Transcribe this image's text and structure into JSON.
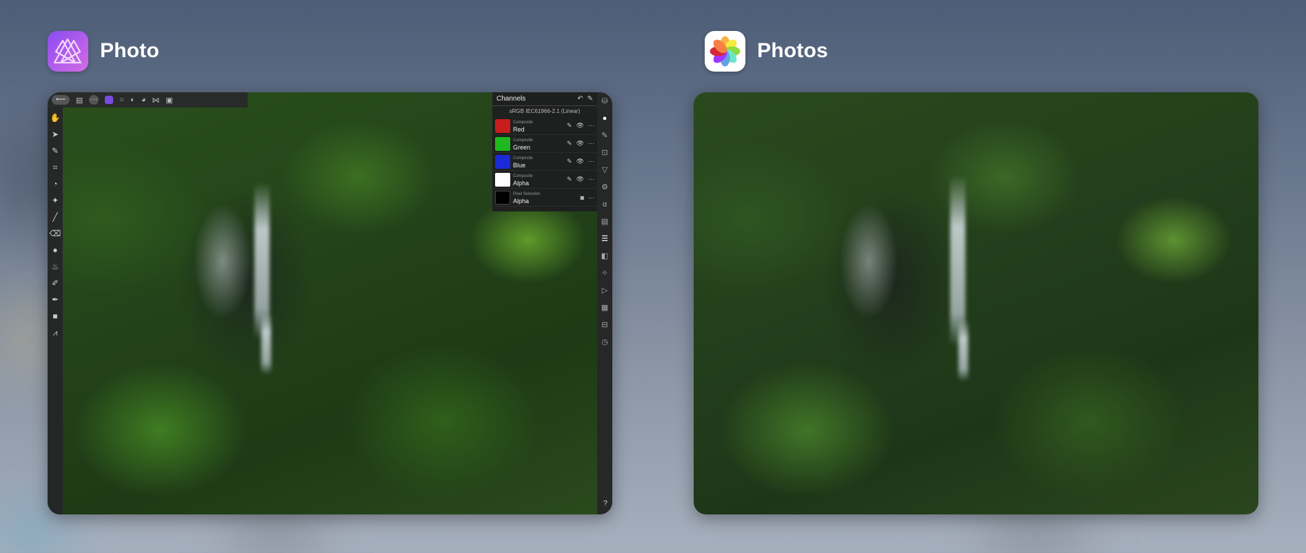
{
  "apps": [
    {
      "name": "Photo",
      "icon": "affinity-photo-icon",
      "toolbar": {
        "back_glyph": "⟵",
        "more_glyph": "···",
        "tool_glyphs": [
          "⊡",
          "○",
          "◐",
          "◕",
          "⋈",
          "▣"
        ]
      },
      "left_tools": [
        "✋",
        "➤",
        "✎",
        "⌗",
        "◔",
        "✦",
        "╱",
        "⌫",
        "●",
        "♨",
        "✐",
        "✒",
        "■",
        "⩘"
      ],
      "right_tools": [
        "⛁",
        "●",
        "✎",
        "⊡",
        "▽",
        "⚙",
        "α",
        "▤",
        "☰",
        "◧",
        "✧",
        "▷",
        "▦",
        "⊟",
        "◷"
      ],
      "help_glyph": "?",
      "channels": {
        "title": "Channels",
        "profile": "sRGB IEC61966-2.1 (Linear)",
        "rows": [
          {
            "sub": "Composite",
            "name": "Red",
            "color": "#c81d1d"
          },
          {
            "sub": "Composite",
            "name": "Green",
            "color": "#1fb81f"
          },
          {
            "sub": "Composite",
            "name": "Blue",
            "color": "#1a2bd6"
          },
          {
            "sub": "Composite",
            "name": "Alpha",
            "color": "#ffffff"
          },
          {
            "sub": "Pixel Selection",
            "name": "Alpha",
            "color": "#000000"
          }
        ]
      }
    },
    {
      "name": "Photos",
      "icon": "apple-photos-icon"
    }
  ]
}
